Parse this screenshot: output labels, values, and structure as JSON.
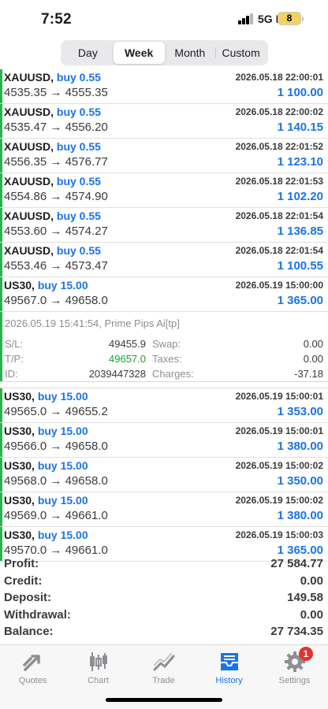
{
  "status": {
    "time": "7:52",
    "network": "5G E",
    "battery": "8"
  },
  "period_tabs": [
    "Day",
    "Week",
    "Month",
    "Custom"
  ],
  "active_period": "Week",
  "deals_a": [
    {
      "symbol": "XAUUSD,",
      "side": "buy 0.55",
      "time": "2026.05.18 22:00:01",
      "open": "4535.35",
      "close": "4555.35",
      "profit": "1 100.00"
    },
    {
      "symbol": "XAUUSD,",
      "side": "buy 0.55",
      "time": "2026.05.18 22:00:02",
      "open": "4535.47",
      "close": "4556.20",
      "profit": "1 140.15"
    },
    {
      "symbol": "XAUUSD,",
      "side": "buy 0.55",
      "time": "2026.05.18 22:01:52",
      "open": "4556.35",
      "close": "4576.77",
      "profit": "1 123.10"
    },
    {
      "symbol": "XAUUSD,",
      "side": "buy 0.55",
      "time": "2026.05.18 22:01:53",
      "open": "4554.86",
      "close": "4574.90",
      "profit": "1 102.20"
    },
    {
      "symbol": "XAUUSD,",
      "side": "buy 0.55",
      "time": "2026.05.18 22:01:54",
      "open": "4553.60",
      "close": "4574.27",
      "profit": "1 136.85"
    },
    {
      "symbol": "XAUUSD,",
      "side": "buy 0.55",
      "time": "2026.05.18 22:01:54",
      "open": "4553.46",
      "close": "4573.47",
      "profit": "1 100.55"
    },
    {
      "symbol": "US30,",
      "side": "buy 15.00",
      "time": "2026.05.19 15:00:00",
      "open": "49567.0",
      "close": "49658.0",
      "profit": "1 365.00"
    }
  ],
  "expanded": {
    "header": "2026.05.19 15:41:54, Prime Pips Ai[tp]",
    "sl_label": "S/L:",
    "sl": "49455.9",
    "tp_label": "T/P:",
    "tp": "49657.0",
    "id_label": "ID:",
    "id": "2039447328",
    "swap_label": "Swap:",
    "swap": "0.00",
    "taxes_label": "Taxes:",
    "taxes": "0.00",
    "charges_label": "Charges:",
    "charges": "-37.18"
  },
  "deals_b": [
    {
      "symbol": "US30,",
      "side": "buy 15.00",
      "time": "2026.05.19 15:00:01",
      "open": "49565.0",
      "close": "49655.2",
      "profit": "1 353.00"
    },
    {
      "symbol": "US30,",
      "side": "buy 15.00",
      "time": "2026.05.19 15:00:01",
      "open": "49566.0",
      "close": "49658.0",
      "profit": "1 380.00"
    },
    {
      "symbol": "US30,",
      "side": "buy 15.00",
      "time": "2026.05.19 15:00:02",
      "open": "49568.0",
      "close": "49658.0",
      "profit": "1 350.00"
    },
    {
      "symbol": "US30,",
      "side": "buy 15.00",
      "time": "2026.05.19 15:00:02",
      "open": "49569.0",
      "close": "49661.0",
      "profit": "1 380.00"
    },
    {
      "symbol": "US30,",
      "side": "buy 15.00",
      "time": "2026.05.19 15:00:03",
      "open": "49570.0",
      "close": "49661.0",
      "profit": "1 365.00"
    }
  ],
  "arrow": "→",
  "summary": [
    {
      "label": "Profit:",
      "value": "27 584.77"
    },
    {
      "label": "Credit:",
      "value": "0.00"
    },
    {
      "label": "Deposit:",
      "value": "149.58"
    },
    {
      "label": "Withdrawal:",
      "value": "0.00"
    },
    {
      "label": "Balance:",
      "value": "27 734.35"
    }
  ],
  "tabbar": {
    "quotes": "Quotes",
    "chart": "Chart",
    "trade": "Trade",
    "history": "History",
    "settings": "Settings",
    "settings_badge": "1",
    "active": "History"
  },
  "colors": {
    "buy": "#1a73e8",
    "profit": "#1a73e8",
    "tp": "#1a9e36",
    "marker": "#2bb24c",
    "badge": "#e5322d"
  },
  "icons": {
    "quotes": "arrows-up-icon",
    "chart": "candlestick-icon",
    "trade": "trend-line-icon",
    "history": "inbox-tray-icon",
    "settings": "gear-icon"
  }
}
